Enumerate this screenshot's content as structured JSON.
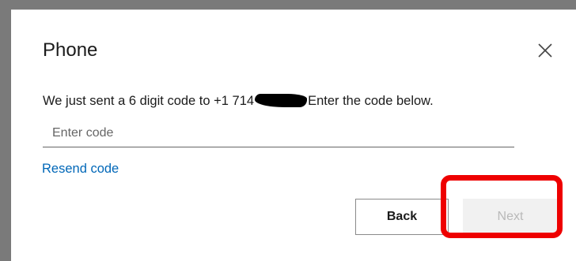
{
  "dialog": {
    "title": "Phone",
    "close_icon": "close-icon",
    "message_prefix": "We just sent a 6 digit code to +1 714",
    "message_suffix": "Enter the code below.",
    "code_input": {
      "placeholder": "Enter code",
      "value": ""
    },
    "resend_label": "Resend code",
    "back_label": "Back",
    "next_label": "Next"
  },
  "colors": {
    "link": "#0067b8",
    "highlight": "#ee0000",
    "next_disabled_bg": "#f1f1f1",
    "next_disabled_text": "#b9b9b9"
  }
}
